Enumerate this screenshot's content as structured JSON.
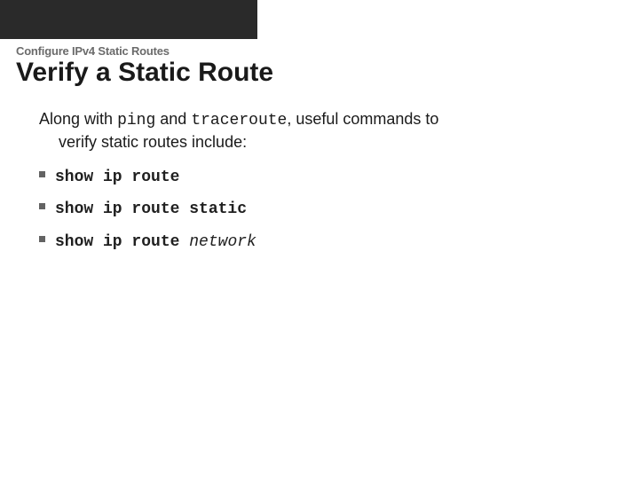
{
  "header": {
    "eyebrow": "Configure IPv4 Static Routes",
    "title": "Verify a Static Route"
  },
  "intro": {
    "pre": "Along with ",
    "cmd1": "ping",
    "mid": " and ",
    "cmd2": "traceroute",
    "post1": ", useful commands to",
    "post2": "verify static routes include:"
  },
  "commands": [
    {
      "text": "show ip route",
      "param": ""
    },
    {
      "text": "show ip route static",
      "param": ""
    },
    {
      "text": "show ip route ",
      "param": "network"
    }
  ]
}
